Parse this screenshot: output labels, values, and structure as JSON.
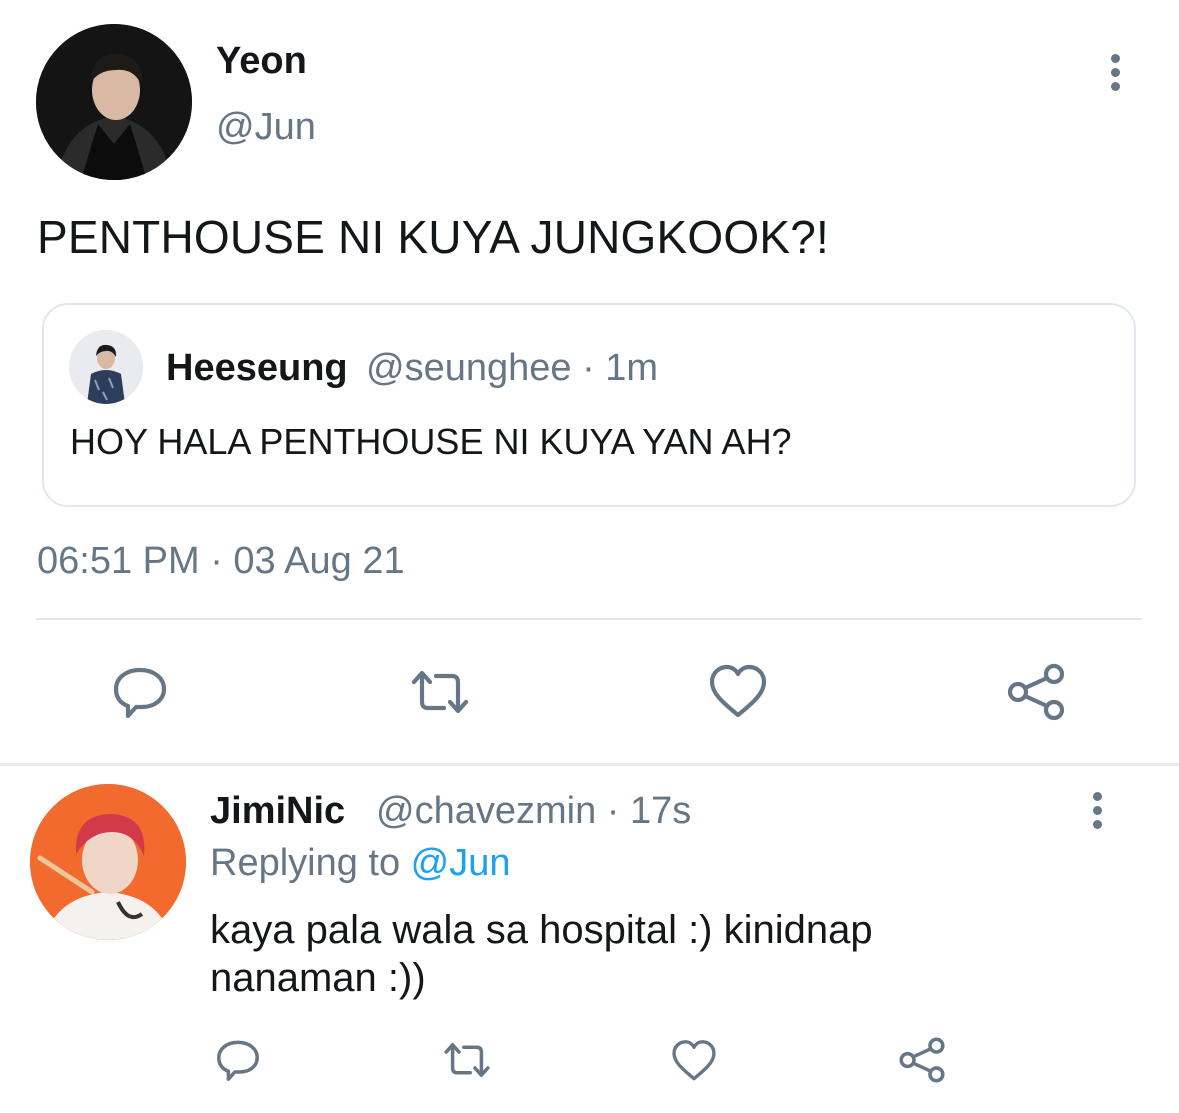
{
  "main_tweet": {
    "display_name": "Yeon",
    "handle": "@Jun",
    "text": "PENTHOUSE NI KUYA JUNGKOOK?!",
    "timestamp": "06:51 PM · 03 Aug 21",
    "quoted": {
      "display_name": "Heeseung",
      "meta": "@seunghee · 1m",
      "text": "HOY HALA PENTHOUSE NI KUYA YAN AH?"
    },
    "actions": [
      "reply-icon",
      "retweet-icon",
      "like-icon",
      "share-icon"
    ]
  },
  "reply": {
    "display_name": "JimiNic",
    "meta": "@chavezmin · 17s",
    "replying_prefix": "Replying to ",
    "replying_handle": "@Jun",
    "text": "kaya pala wala sa hospital :) kinidnap nanaman :))",
    "actions": [
      "reply-icon",
      "retweet-icon",
      "like-icon",
      "share-icon"
    ]
  },
  "colors": {
    "text": "#14171a",
    "secondary": "#657786",
    "link": "#1da1f2",
    "border": "#e1e8ed"
  }
}
